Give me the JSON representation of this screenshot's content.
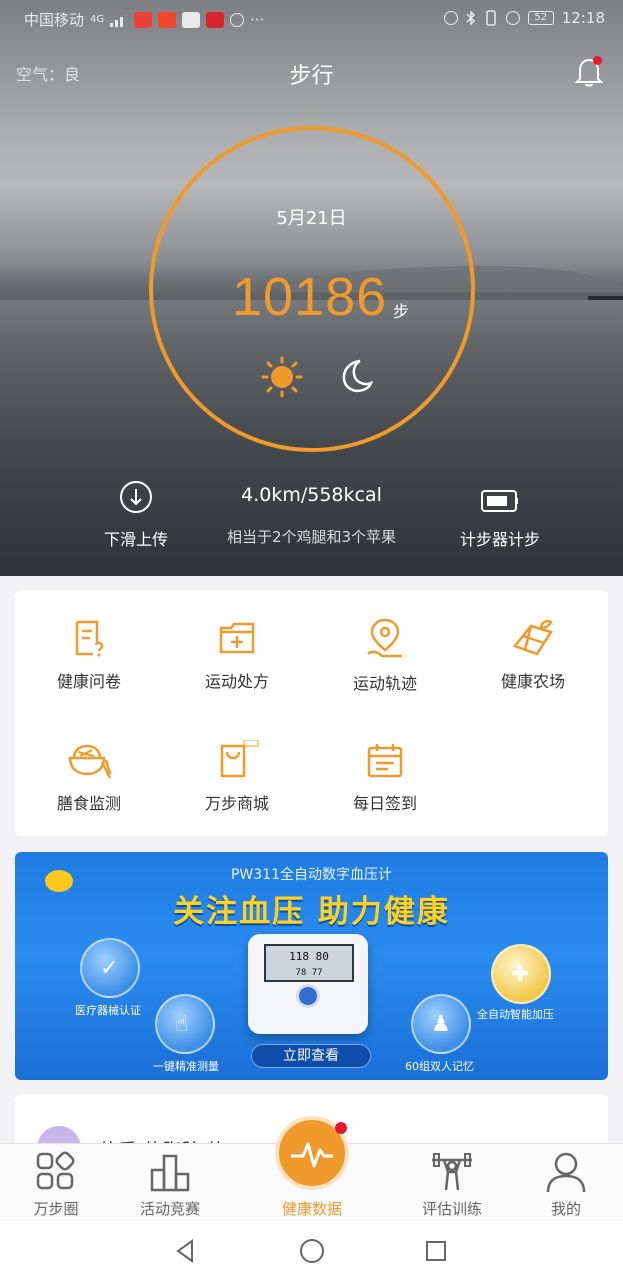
{
  "status_bar": {
    "carrier": "中国移动",
    "network": "4G",
    "battery": "52",
    "time": "12:18",
    "more": "···"
  },
  "header": {
    "air_quality": "空气：良",
    "title": "步行"
  },
  "steps_panel": {
    "date": "5月21日",
    "steps": "10186",
    "unit": "步"
  },
  "hero_actions": {
    "upload_label": "下滑上传",
    "distance_calories": "4.0km/558kcal",
    "equivalent": "相当于2个鸡腿和3个苹果",
    "pedometer_label": "计步器计步"
  },
  "features": [
    {
      "label": "健康问卷",
      "icon": "questionnaire-icon"
    },
    {
      "label": "运动处方",
      "icon": "prescription-icon"
    },
    {
      "label": "运动轨迹",
      "icon": "location-track-icon"
    },
    {
      "label": "健康农场",
      "icon": "farm-icon"
    },
    {
      "label": "膳食监测",
      "icon": "diet-bowl-icon"
    },
    {
      "label": "万步商城",
      "icon": "shopping-bag-icon"
    },
    {
      "label": "每日签到",
      "icon": "calendar-checkin-icon"
    }
  ],
  "banner": {
    "model": "PW311全自动数字血压计",
    "slogan": "关注血压  助力健康",
    "badge_1": "医疗器械认证",
    "badge_2": "一键精准测量",
    "badge_3": "60组双人记忆",
    "badge_4": "全自动智能加压",
    "cta": "立即查看",
    "screen_top": "118 80",
    "screen_bottom": "78 77"
  },
  "next_card": {
    "title": "体重/体脂肪/体..."
  },
  "tabbar": {
    "tab_1": "万步圈",
    "tab_2": "活动竞赛",
    "tab_center": "健康数据",
    "tab_4": "评估训练",
    "tab_5": "我的"
  },
  "colors": {
    "accent": "#f09a2c",
    "alert": "#e8182b",
    "banner_blue": "#2a8cf0"
  }
}
